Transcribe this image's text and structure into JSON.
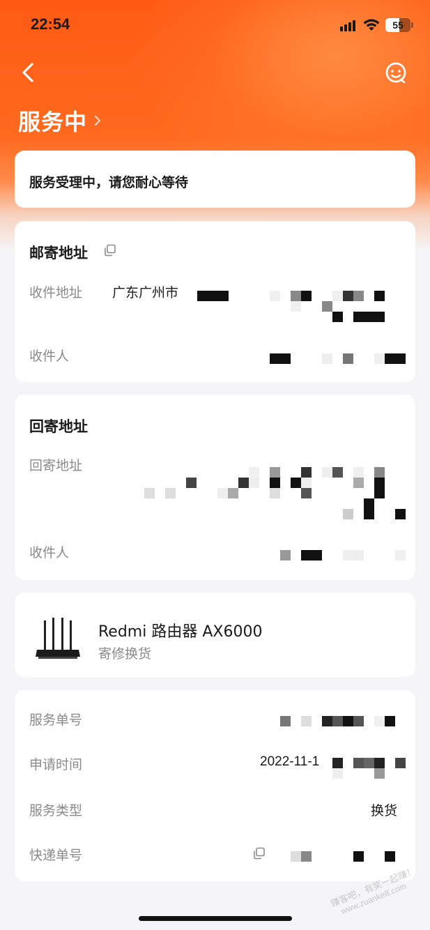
{
  "status_bar": {
    "time": "22:54",
    "battery_level": "55"
  },
  "header": {
    "title": "服务中",
    "back_icon": "chevron-left-icon",
    "service_icon": "customer-service-icon",
    "title_arrow_icon": "chevron-right-icon",
    "background_color": "#ff5a14"
  },
  "notice": {
    "text": "服务受理中，请您耐心等待"
  },
  "mailing_address": {
    "title": "邮寄地址",
    "address_label": "收件地址",
    "address_value": "广东广州市",
    "recipient_label": "收件人"
  },
  "return_address": {
    "title": "回寄地址",
    "address_label": "回寄地址",
    "recipient_label": "收件人"
  },
  "product": {
    "name": "Redmi 路由器 AX6000",
    "service": "寄修换货"
  },
  "details": {
    "order_no_label": "服务单号",
    "apply_time_label": "申请时间",
    "apply_time_value": "2022-11-1",
    "service_type_label": "服务类型",
    "service_type_value": "换货",
    "tracking_label": "快递单号"
  },
  "watermark": {
    "line1": "赚客吧，有奖一起赚！",
    "line2": "www.zuanke8.com"
  }
}
